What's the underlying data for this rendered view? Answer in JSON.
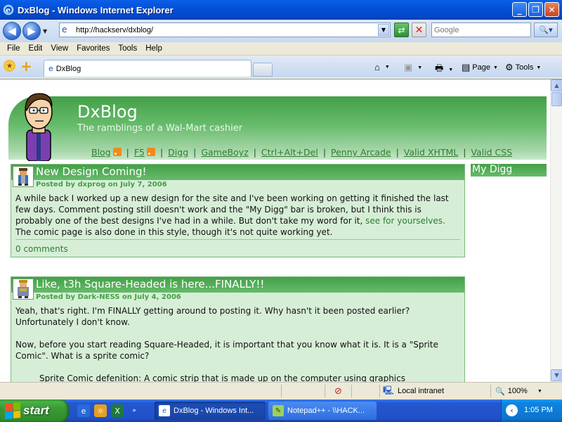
{
  "window": {
    "title": "DxBlog - Windows Internet Explorer",
    "minimize": "_",
    "maximize": "❐",
    "close": "✕"
  },
  "toolbar": {
    "address": "http://hackserv/dxblog/",
    "search_placeholder": "Google"
  },
  "menu": [
    "File",
    "Edit",
    "View",
    "Favorites",
    "Tools",
    "Help"
  ],
  "tab": {
    "label": "DxBlog"
  },
  "commands": {
    "page": "Page",
    "tools": "Tools"
  },
  "site": {
    "title": "DxBlog",
    "tagline": "The ramblings of a Wal-Mart cashier",
    "nav": [
      "Blog",
      "F5",
      "Digg",
      "GameBoyz",
      "Ctrl+Alt+Del",
      "Penny Arcade",
      "Valid XHTML",
      "Valid CSS"
    ]
  },
  "sidebar": {
    "title": "My Digg"
  },
  "posts": [
    {
      "title": "New Design Coming!",
      "meta": "Posted by dxprog on July 7, 2006",
      "body_text": "A while back I worked up a new design for the site and I've been working on getting it finished the last few days. Comment posting still doesn't work and the \"My Digg\" bar is broken, but I think this is probably one of the best designs I've had in a while. But don't take my word for it,",
      "link": "see for yourselves.",
      "body_after": " The comic page is also done in this style, though it's not quite working yet.",
      "comments": "0 comments"
    },
    {
      "title": "Like, t3h Square-Headed is here...FINALLY!!",
      "meta": "Posted by Dark-NESS on July 4, 2006",
      "p1": "Yeah, that's right. I'm FINALLY getting around to posting it. Why hasn't it been posted earlier? Unfortunately I don't know.",
      "p2": "Now, before you start reading Square-Headed, it is important that you know what it is. It is a \"Sprite Comic\". What is a sprite comic?",
      "p3": "Sprite Comic defenition: A comic strip that is made up on the computer using graphics"
    }
  ],
  "status": {
    "zone": "Local intranet",
    "zoom": "100%"
  },
  "taskbar": {
    "start": "start",
    "tasks": [
      "DxBlog - Windows Int...",
      "Notepad++ - \\\\HACK..."
    ],
    "clock": "1:05 PM"
  },
  "colors": {
    "accent_green": "#43a047",
    "light_green": "#d6eed6",
    "xp_blue": "#0451d8"
  }
}
